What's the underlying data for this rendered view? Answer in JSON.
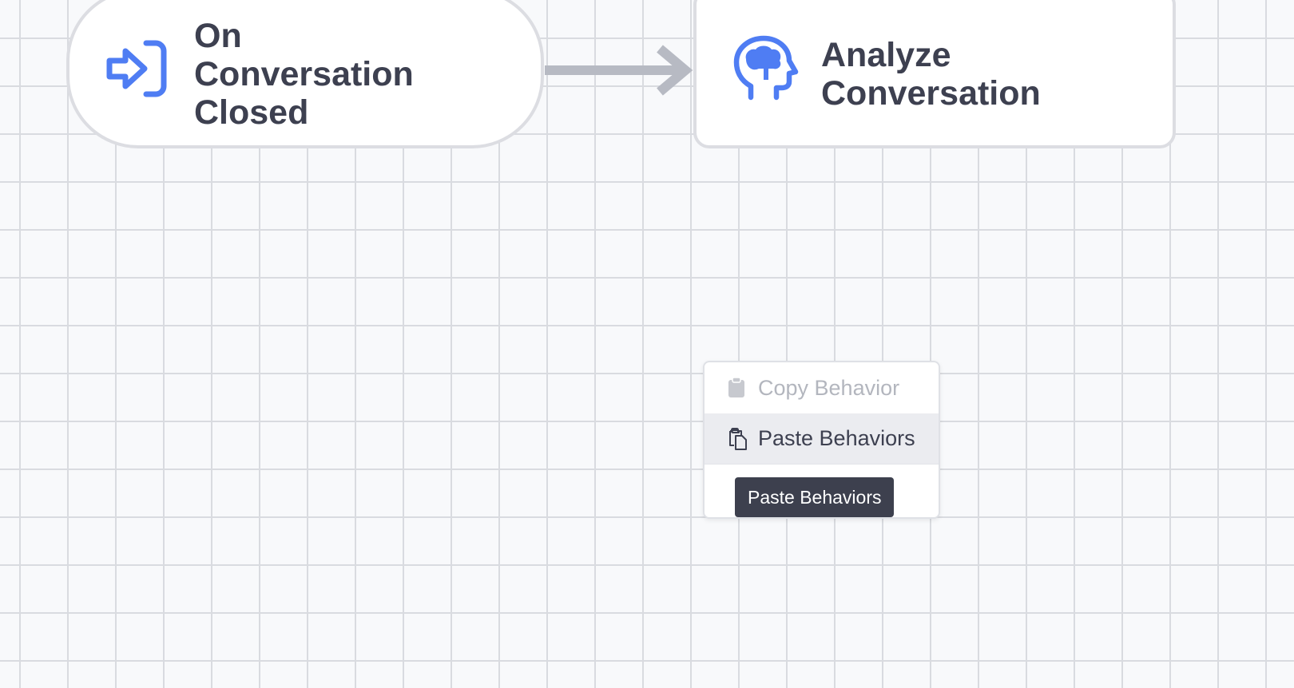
{
  "nodes": {
    "trigger": {
      "label": "On Conversation Closed",
      "icon": "sign-in-arrow-icon",
      "icon_color": "#4f7df3"
    },
    "action": {
      "label": "Analyze Conversation",
      "icon": "brain-head-icon",
      "icon_color": "#4f7df3"
    }
  },
  "connector_color": "#b7bac3",
  "context_menu": {
    "items": [
      {
        "label": "Copy Behavior",
        "icon": "clipboard-icon",
        "state": "disabled"
      },
      {
        "label": "Paste Behaviors",
        "icon": "paste-icon",
        "state": "hover"
      }
    ]
  },
  "tooltip": {
    "text": "Paste Behaviors"
  },
  "colors": {
    "canvas_bg": "#f8f9fb",
    "grid_line": "#d9dbe0",
    "node_border": "#dcdde2",
    "text_dark": "#3d4050",
    "accent": "#4f7df3",
    "tooltip_bg": "#3d404e"
  }
}
